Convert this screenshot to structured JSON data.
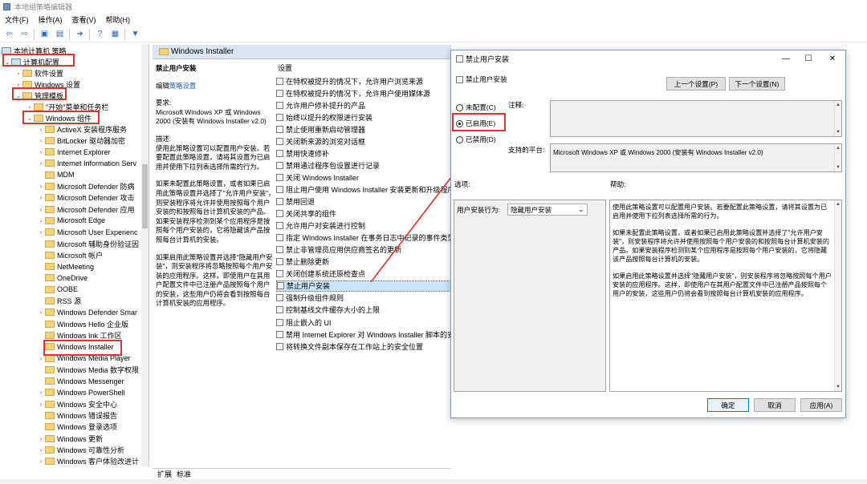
{
  "window": {
    "title": "本地组策略编辑器"
  },
  "menu": [
    "文件(F)",
    "操作(A)",
    "查看(V)",
    "帮助(H)"
  ],
  "tree": {
    "root": "本地计算机 策略",
    "computer_config": "计算机配置",
    "software": "软件设置",
    "windows_settings": "Windows 设置",
    "admin_templates": "管理模板",
    "start_menu": "\"开始\"菜单和任务栏",
    "windows_components": "Windows 组件",
    "components": [
      "ActiveX 安装程序服务",
      "BitLocker 驱动器加密",
      "Internet Explorer",
      "Internet Information Serv",
      "MDM",
      "Microsoft Defender 防病",
      "Microsoft Defender 攻击",
      "Microsoft Defender 应用",
      "Microsoft Edge",
      "Microsoft User Experienc",
      "Microsoft 辅助身份验证因",
      "Microsoft 帐户",
      "NetMeeting",
      "OneDrive",
      "OOBE",
      "RSS 源",
      "Windows Defender Smar",
      "Windows Hello 企业版",
      "Windows Ink 工作区",
      "Windows Installer",
      "Windows Media Player",
      "Windows Media 数字权限",
      "Windows Messenger",
      "Windows PowerShell",
      "Windows 安全中心",
      "Windows 错误报告",
      "Windows 登录选项",
      "Windows 更新",
      "Windows 可靠性分析",
      "Windows 客户体验改进计"
    ]
  },
  "panel": {
    "header": "Windows Installer",
    "desc_title": "禁止用户安装",
    "edit_prefix": "编辑",
    "edit_link": "策略设置",
    "req_label": "要求:",
    "req_text": "Microsoft Windows XP 或 Windows 2000 (安装有 Windows Installer v2.0)",
    "desc_label": "描述:",
    "desc_p1": "使用此策略设置可以配置用户安装。若要配置此策略设置，请将其设置为已启用并使用下拉列表选择所需的行为。",
    "desc_p2": "如果未配置此策略设置，或者如果已启用此策略设置并选择了\"允许用户安装\"，则安装程序将允许并使用按照每个用户安装的和按照每台计算机安装的产品。如果安装程序检测到某个应用程序是按照每个用户安装的，它将隐藏该产品按照每台计算机的安装。",
    "desc_p3": "如果启用此策略设置并选择\"隐藏用户安装\"，则安装程序将忽略按照每个用户安装的应用程序。这样，即使用户在其用户配置文件中已注册产品按照每个用户的安装，这些用户仍将会看到按照每台计算机安装的应用程序。",
    "settings_header": "设置",
    "settings": [
      "在特权被提升的情况下，允许用户浏览来源",
      "在特权被提升的情况下，允许用户使用媒体源",
      "允许用户修补提升的产品",
      "始终以提升的权限进行安装",
      "禁止使用重新启动管理器",
      "关闭新来源的浏览对话框",
      "禁用快速修补",
      "禁用通过程序包设置进行记录",
      "关闭 Windows Installer",
      "阻止用户使用 Windows Installer 安装更新和升级程序",
      "禁用回退",
      "关闭共享的组件",
      "允许用户对安装进行控制",
      "指定 Windows Installer 在事务日志中记录的事件类型",
      "禁止非管理员应用供应商签名的更新",
      "禁止删除更新",
      "关闭创建系统还原检查点",
      "禁止用户安装",
      "强制升级组件规则",
      "控制基线文件缓存大小的上限",
      "阻止嵌入的 UI",
      "禁用 Internet Explorer 对 Windows Installer 脚本的安全提示",
      "将转换文件副本保存在工作站上的安全位置"
    ],
    "selected_index": 17,
    "tabs": [
      "扩展",
      "标准"
    ]
  },
  "dialog": {
    "title": "禁止用户安装",
    "setting_name": "禁止用户安装",
    "prev_btn": "上一个设置(P)",
    "next_btn": "下一个设置(N)",
    "radio_not_configured": "未配置(C)",
    "radio_enabled": "已启用(E)",
    "radio_disabled": "已禁用(D)",
    "comment_label": "注释:",
    "platform_label": "支持的平台:",
    "platform_text": "Microsoft Windows XP 或 Windows 2000 (安装有 Windows Installer v2.0)",
    "options_label": "选项:",
    "help_label": "帮助:",
    "behavior_label": "用户安装行为:",
    "behavior_value": "隐藏用户安装",
    "help_p1": "使用此策略设置可以配置用户安装。若要配置此策略设置，请将其设置为已启用并使用下拉列表选择所需的行为。",
    "help_p2": "如果未配置此策略设置，或者如果已启用此策略设置并选择了\"允许用户安装\"，则安装程序将允许并使用按照每个用户安装的和按照每台计算机安装的产品。如果安装程序检测到某个应用程序是按照每个用户安装的，它将隐藏该产品按照每台计算机的安装。",
    "help_p3": "如果启用此策略设置并选择\"隐藏用户安装\"，则安装程序将忽略按照每个用户安装的应用程序。这样，即使用户在其用户配置文件中已注册产品按照每个用户的安装，这些用户仍将会看到按照每台计算机安装的应用程序。",
    "ok_btn": "确定",
    "cancel_btn": "取消",
    "apply_btn": "应用(A)"
  },
  "colors": {
    "highlight": "#e0312f",
    "selection": "#cce4f7",
    "header": "#dce6f2"
  }
}
